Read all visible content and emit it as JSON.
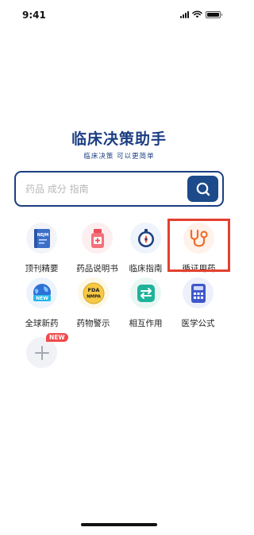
{
  "status_bar": {
    "time": "9:41"
  },
  "brand": {
    "title": "临床决策助手",
    "subtitle": "临床决策 可以更简单"
  },
  "search": {
    "placeholder": "药品 成分 指南",
    "button_icon": "search-icon"
  },
  "tiles": [
    {
      "label": "顶刊精要",
      "icon": "journal-book-icon",
      "icon_text": "NEJM"
    },
    {
      "label": "药品说明书",
      "icon": "medicine-bottle-icon"
    },
    {
      "label": "临床指南",
      "icon": "compass-icon"
    },
    {
      "label": "循证用药",
      "icon": "stethoscope-icon",
      "highlighted": true
    },
    {
      "label": "全球新药",
      "icon": "globe-new-icon",
      "icon_text": "NEW"
    },
    {
      "label": "药物警示",
      "icon": "fda-nmpa-icon",
      "icon_text": [
        "FDA",
        "NMPA"
      ]
    },
    {
      "label": "相互作用",
      "icon": "interaction-arrows-icon"
    },
    {
      "label": "医学公式",
      "icon": "calculator-icon"
    },
    {
      "label": "",
      "icon": "add-plus-icon",
      "badge": "NEW"
    }
  ],
  "colors": {
    "brand_blue": "#1c3f82",
    "highlight_red": "#e3412f",
    "badge_red": "#f24b4b",
    "stethoscope_orange": "#ef6d2d"
  }
}
